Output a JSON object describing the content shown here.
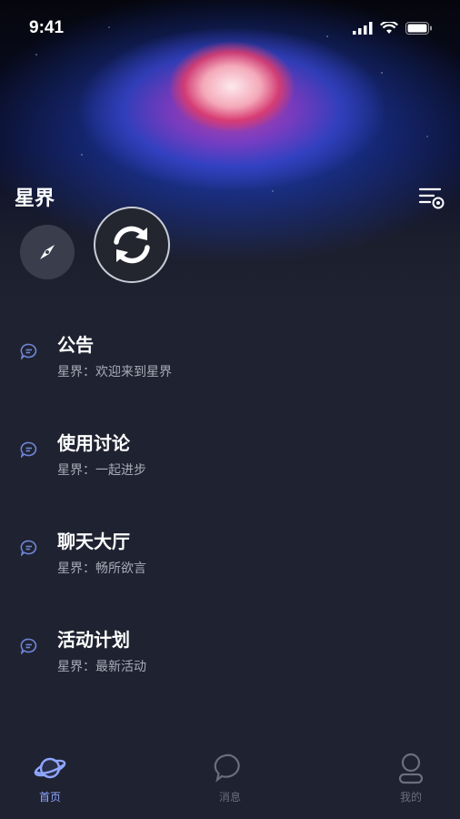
{
  "status": {
    "time": "9:41"
  },
  "header": {
    "title": "星界"
  },
  "channels": [
    {
      "name": "公告",
      "desc": "星界：欢迎来到星界"
    },
    {
      "name": "使用讨论",
      "desc": "星界：一起进步"
    },
    {
      "name": "聊天大厅",
      "desc": "星界：畅所欲言"
    },
    {
      "name": "活动计划",
      "desc": "星界：最新活动"
    }
  ],
  "tabs": [
    {
      "label": "首页",
      "icon": "planet-icon",
      "active": true
    },
    {
      "label": "消息",
      "icon": "chat-bubble-icon",
      "active": false
    },
    {
      "label": "我的",
      "icon": "profile-icon",
      "active": false
    }
  ],
  "colors": {
    "background": "#1f2230",
    "accent": "#8fa6ff",
    "inactive": "#6b6f7c",
    "subtext": "#a8acb8"
  }
}
